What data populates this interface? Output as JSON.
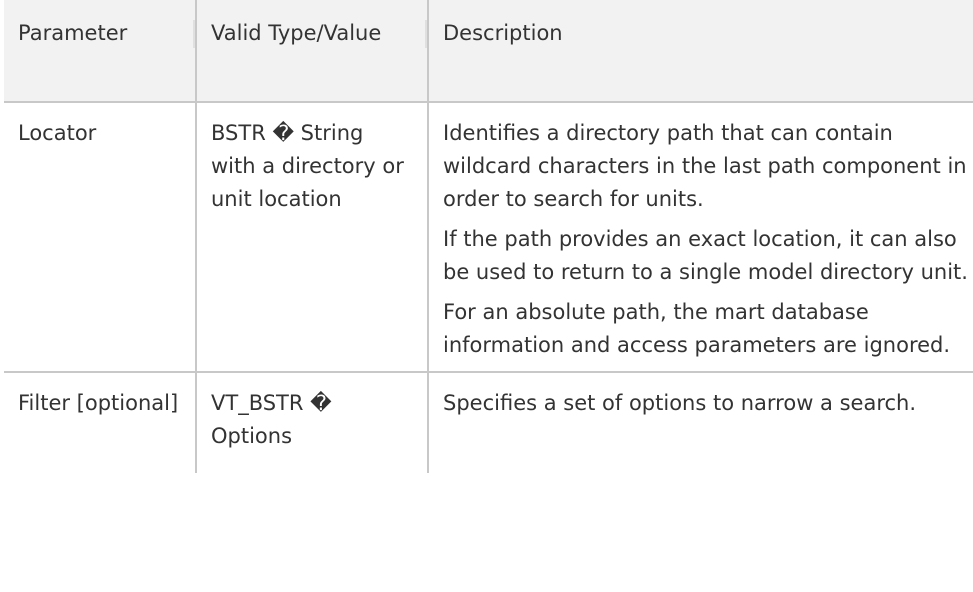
{
  "table": {
    "headers": [
      "Parameter",
      "Valid Type/Value",
      "Description"
    ],
    "rows": [
      {
        "parameter": "Locator",
        "type": "BSTR � String with a directory or unit location",
        "description": [
          "Identifies a directory path that can contain wildcard characters in the last path component in order to search for units.",
          "If the path provides an exact location, it can also be used to return to a single model directory unit.",
          "For an absolute path, the mart database information and access parameters are ignored."
        ]
      },
      {
        "parameter": "Filter [optional]",
        "type": "VT_BSTR � Options",
        "description": [
          "Specifies a set of options to narrow a search."
        ]
      }
    ]
  }
}
